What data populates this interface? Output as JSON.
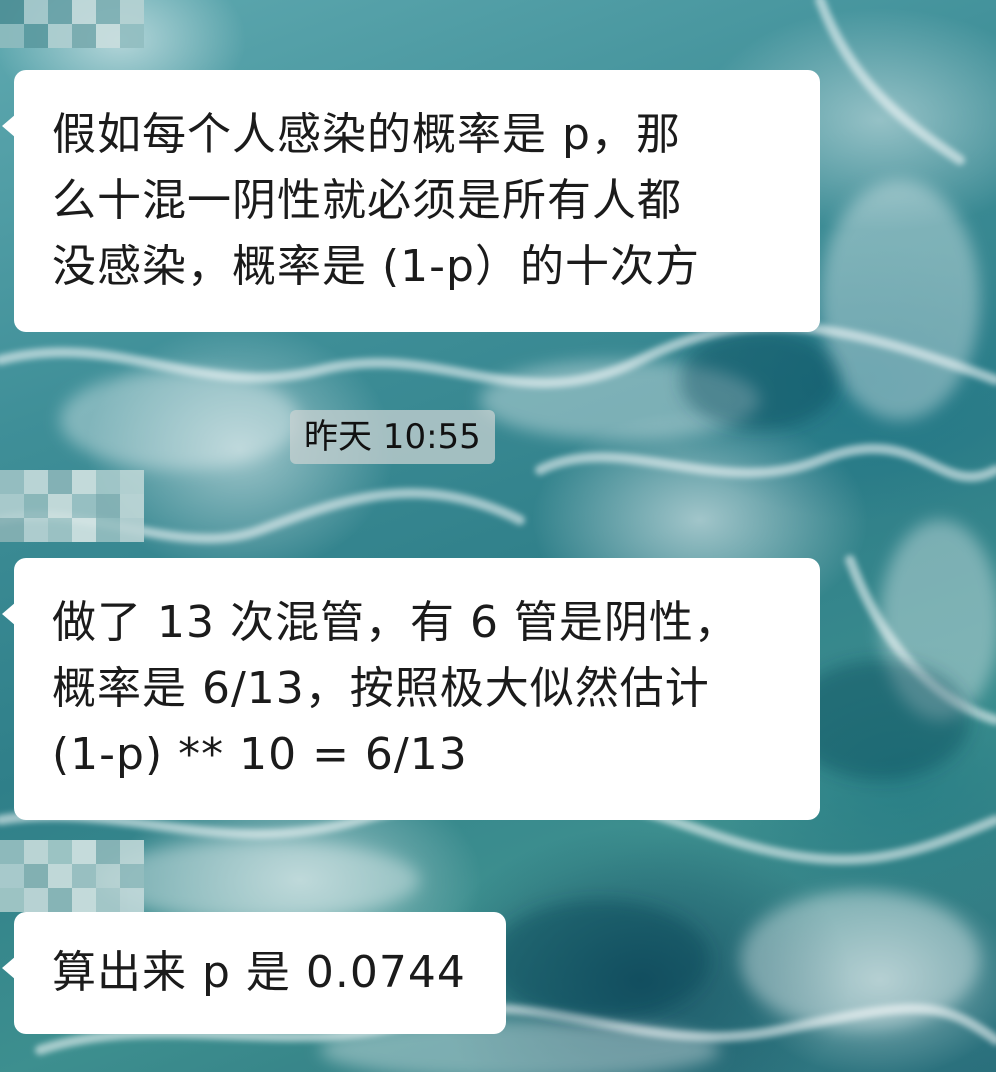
{
  "messages": [
    {
      "lines": [
        "假如每个人感染的概率是 p，那",
        "么十混一阴性就必须是所有人都",
        "没感染，概率是 (1-p）的十次方"
      ]
    },
    {
      "lines": [
        "做了 13 次混管，有 6 管是阴性，",
        "概率是 6/13，按照极大似然估计",
        "(1-p) ** 10 = 6/13"
      ]
    },
    {
      "lines": [
        "算出来 p 是 0.0744"
      ]
    }
  ],
  "timestamp": "昨天 10:55",
  "avatar_icon": "pixelated-avatar-icon",
  "colors": {
    "bubble": "#ffffff",
    "text": "#1b1b1b",
    "background": "#3f8f98"
  }
}
